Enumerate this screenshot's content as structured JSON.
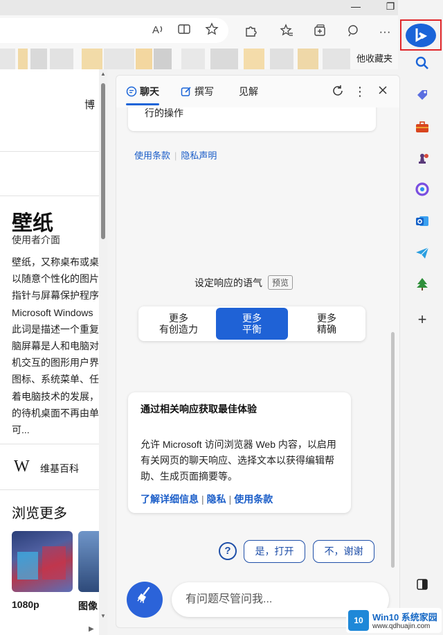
{
  "window": {
    "minimize": "—",
    "restore": "❐",
    "close": "✕"
  },
  "toolbar": {
    "icons": [
      "read-aloud-icon",
      "split-screen-icon",
      "add-favorite-icon",
      "extensions-icon",
      "favorites-icon",
      "collections-icon",
      "copilot-icon",
      "more-icon"
    ],
    "more_label": "···"
  },
  "favorites_bar": {
    "other_favorites_label": "他收藏夹"
  },
  "webpage": {
    "top_text": "博",
    "article_title": "壁纸",
    "article_subtitle": "使用者介面",
    "article_lines": [
      "壁纸，又称桌布或桌",
      "以随意个性化的图片",
      "指针与屏幕保护程序",
      "Microsoft Windows",
      "此词是描述一个重复",
      "脑屏幕是人和电脑对",
      "机交互的图形用户界",
      "图标、系统菜单、任",
      "着电脑技术的发展，",
      "的待机桌面不再由单",
      "可..."
    ],
    "source_label": "维基百科",
    "browse_more": "浏览更多",
    "thumbnails": [
      {
        "caption": "1080p"
      },
      {
        "caption": "图像"
      }
    ]
  },
  "copilot": {
    "tabs": [
      {
        "label": "聊天",
        "active": true
      },
      {
        "label": "撰写",
        "active": false
      },
      {
        "label": "见解",
        "active": false
      }
    ],
    "previous_message_fragment": "行的操作",
    "terms_label": "使用条款",
    "privacy_label": "隐私声明",
    "tone_heading": "设定响应的语气",
    "preview_badge": "预览",
    "tones": [
      {
        "line1": "更多",
        "line2": "有创造力",
        "selected": false
      },
      {
        "line1": "更多",
        "line2": "平衡",
        "selected": true
      },
      {
        "line1": "更多",
        "line2": "精确",
        "selected": false
      }
    ],
    "permission_card": {
      "title": "通过相关响应获取最佳体验",
      "body": "允许 Microsoft 访问浏览器 Web 内容，以启用有关网页的聊天响应、选择文本以获得编辑帮助、生成页面摘要等。",
      "link_learn_more": "了解详细信息",
      "link_privacy": "隐私",
      "link_terms": "使用条款"
    },
    "help_label": "?",
    "yes_button": "是，打开",
    "no_button": "不，谢谢",
    "input_placeholder": "有问题尽管问我..."
  },
  "sidebar": {
    "icons": [
      "copilot-icon",
      "search-icon",
      "shopping-icon",
      "tools-icon",
      "games-icon",
      "office-icon",
      "outlook-icon",
      "telegram-icon",
      "tree-icon",
      "add-icon",
      "split-panel-icon"
    ]
  },
  "watermark": {
    "logo_text": "10",
    "title": "Win10 系统家园",
    "url": "www.qdhuajin.com"
  },
  "colors": {
    "accent": "#1f62d6",
    "highlight_frame": "#e0262a",
    "link": "#1a5dc8"
  }
}
